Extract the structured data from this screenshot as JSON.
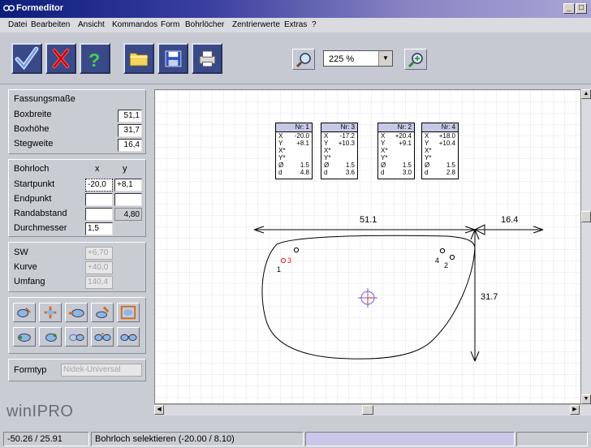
{
  "window": {
    "title": "Formeditor"
  },
  "menu": [
    "Datei",
    "Bearbeiten",
    "Ansicht",
    "Kommandos",
    "Form",
    "Bohrlöcher",
    "Zentrierwerte",
    "Extras",
    "?"
  ],
  "toolbar": {
    "zoom_value": "225 %",
    "buttons": [
      "ok",
      "cancel",
      "help",
      "open",
      "save",
      "print",
      "zoom",
      "zoom-fit"
    ]
  },
  "fassung": {
    "title": "Fassungsmaße",
    "boxbreite_label": "Boxbreite",
    "boxbreite": "51,1",
    "boxhoehe_label": "Boxhöhe",
    "boxhoehe": "31,7",
    "stegweite_label": "Stegweite",
    "stegweite": "16,4"
  },
  "bohrloch": {
    "title": "Bohrloch",
    "x_label": "x",
    "y_label": "y",
    "startpunkt_label": "Startpunkt",
    "start_x": "-20,0",
    "start_y": "+8,1",
    "endpunkt_label": "Endpunkt",
    "end_x": "",
    "end_y": "",
    "randabstand_label": "Randabstand",
    "randabstand": "",
    "randabstand_ro": "4,80",
    "durchmesser_label": "Durchmesser",
    "durchmesser": "1,5"
  },
  "sw": {
    "sw_label": "SW",
    "sw": "+6,70",
    "kurve_label": "Kurve",
    "kurve": "+40,0",
    "umfang_label": "Umfang",
    "umfang": "140,4"
  },
  "formtyp": {
    "label": "Formtyp",
    "value": "Nidek-Universal"
  },
  "brand": "winIPRO",
  "drawing": {
    "width": "51.1",
    "bridge": "16.4",
    "height": "31.7",
    "holes": [
      {
        "title": "Nr: 1",
        "x": "-20.0",
        "y": "+8.1",
        "diam": "1.5",
        "d": "4.8"
      },
      {
        "title": "Nr: 3",
        "x": "-17.2",
        "y": "+10.3",
        "diam": "1.5",
        "d": "3.6"
      },
      {
        "title": "Nr: 2",
        "x": "+20.4",
        "y": "+9.1",
        "diam": "1.5",
        "d": "3.0"
      },
      {
        "title": "Nr: 4",
        "x": "+18.0",
        "y": "+10.4",
        "diam": "1.5",
        "d": "2.8"
      }
    ],
    "labels": {
      "x": "X",
      "y": "Y",
      "xs": "X*",
      "ys": "Y*",
      "o": "Ø",
      "d": "d"
    },
    "hole_markers": [
      "1",
      "3",
      "4",
      "2"
    ]
  },
  "status": {
    "coords": "-50.26 / 25.91",
    "message": "Bohrloch selektieren (-20.00 / 8.10)"
  }
}
